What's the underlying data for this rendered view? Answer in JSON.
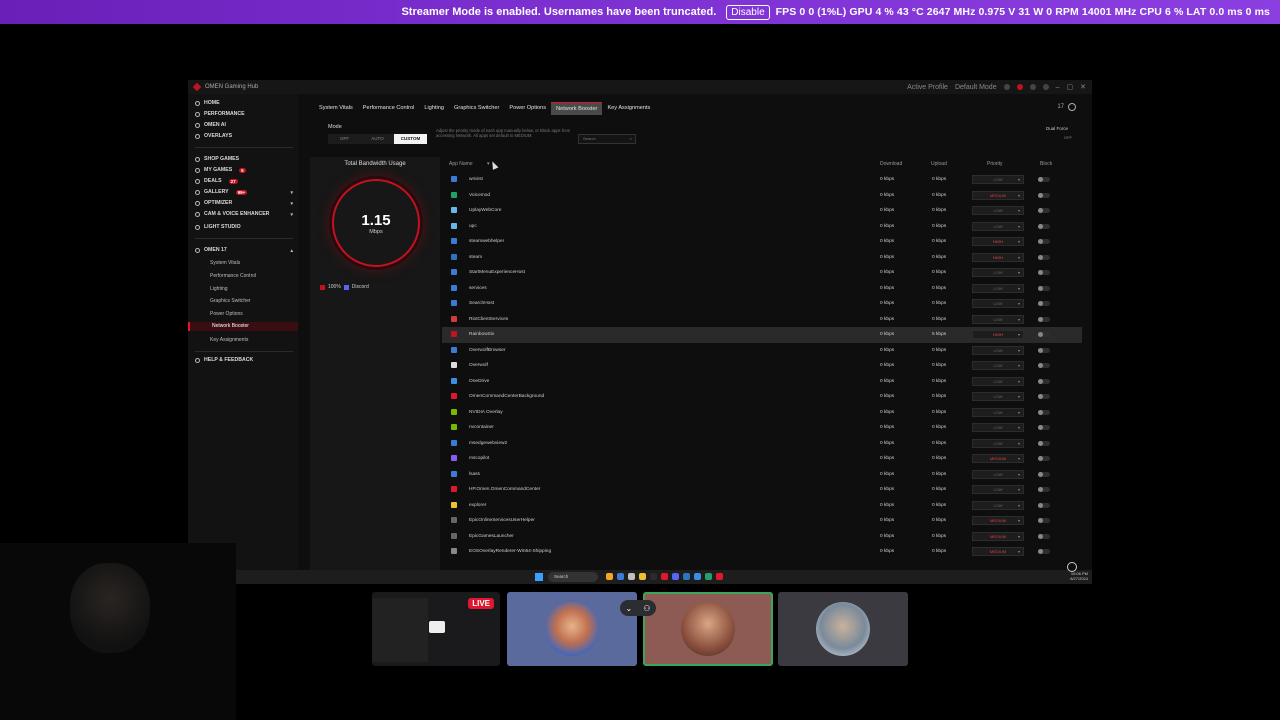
{
  "overlay": {
    "streamer_message": "Streamer Mode is enabled. Usernames have been truncated.",
    "disable_label": "Disable",
    "stats": "FPS 0 0 (1%L)  GPU 4 % 43 °C 2647 MHz 0.975 V 31 W 0 RPM 14001 MHz  CPU 6 %  LAT 0.0 ms 0 ms"
  },
  "window": {
    "title": "OMEN Gaming Hub",
    "profile_label": "Active Profile",
    "profile_value": "Default Mode"
  },
  "sidebar": {
    "items": [
      {
        "label": "HOME"
      },
      {
        "label": "PERFORMANCE"
      },
      {
        "label": "OMEN AI"
      },
      {
        "label": "OVERLAYS"
      },
      {
        "label": "SHOP GAMES"
      },
      {
        "label": "MY GAMES",
        "badge": "5"
      },
      {
        "label": "DEALS",
        "badge": "27"
      },
      {
        "label": "GALLERY",
        "badge": "99+"
      },
      {
        "label": "OPTIMIZER"
      },
      {
        "label": "CAM & VOICE ENHANCER"
      },
      {
        "label": "LIGHT STUDIO"
      }
    ],
    "device": "OMEN 17",
    "sub_items": [
      {
        "label": "System Vitals"
      },
      {
        "label": "Performance Control"
      },
      {
        "label": "Lighting"
      },
      {
        "label": "Graphics Switcher"
      },
      {
        "label": "Power Options"
      },
      {
        "label": "Network Booster"
      },
      {
        "label": "Key Assignments"
      }
    ],
    "help": "HELP & FEEDBACK",
    "version": "BOOSTED"
  },
  "tabs": [
    {
      "label": "System Vitals"
    },
    {
      "label": "Performance Control"
    },
    {
      "label": "Lighting"
    },
    {
      "label": "Graphics Switcher"
    },
    {
      "label": "Power Options"
    },
    {
      "label": "Network Booster",
      "active": true
    },
    {
      "label": "Key Assignments"
    }
  ],
  "tab_right": "17",
  "mode": {
    "label": "Mode",
    "options": [
      "OFF",
      "AUTO",
      "CUSTOM"
    ],
    "selected": "CUSTOM",
    "description": "Adjust the priority mode of each app manually below, or Block apps from accessing Network. All apps set default to MEDIUM.",
    "search_placeholder": "Search",
    "dual_force": "Dual Force",
    "dual_toggle": "OFF"
  },
  "bandwidth": {
    "title": "Total Bandwidth Usage",
    "value": "1.15",
    "unit": "Mbps",
    "legend_percent": "100%",
    "legend_app": "Discord"
  },
  "table": {
    "headers": {
      "app": "App Name",
      "download": "Download",
      "upload": "Upload",
      "priority": "Priority",
      "block": "Block"
    },
    "rows": [
      {
        "name": "wmirst",
        "dl": "0 kbps",
        "ul": "0 kbps",
        "prio": "LOW",
        "color": "#3b7bd6"
      },
      {
        "name": "Voicemod",
        "dl": "0 kbps",
        "ul": "0 kbps",
        "prio": "MEDIUM",
        "color": "#1fa36a"
      },
      {
        "name": "UplayWebCore",
        "dl": "0 kbps",
        "ul": "0 kbps",
        "prio": "LOW",
        "color": "#6bb6e8"
      },
      {
        "name": "upc",
        "dl": "0 kbps",
        "ul": "0 kbps",
        "prio": "LOW",
        "color": "#6bb6e8"
      },
      {
        "name": "steamwebhelper",
        "dl": "0 kbps",
        "ul": "0 kbps",
        "prio": "HIGH",
        "color": "#3b7bd6"
      },
      {
        "name": "steam",
        "dl": "0 kbps",
        "ul": "0 kbps",
        "prio": "HIGH",
        "color": "#2a75bb"
      },
      {
        "name": "StartMenuExperienceHost",
        "dl": "0 kbps",
        "ul": "0 kbps",
        "prio": "LOW",
        "color": "#3b7bd6"
      },
      {
        "name": "services",
        "dl": "0 kbps",
        "ul": "0 kbps",
        "prio": "LOW",
        "color": "#3b7bd6"
      },
      {
        "name": "SearchHost",
        "dl": "0 kbps",
        "ul": "0 kbps",
        "prio": "LOW",
        "color": "#3b7bd6"
      },
      {
        "name": "RiotClientServices",
        "dl": "0 kbps",
        "ul": "0 kbps",
        "prio": "LOW",
        "color": "#d23b3b"
      },
      {
        "name": "RainbowSix",
        "dl": "0 kbps",
        "ul": "5 kbps",
        "prio": "HIGH",
        "color": "#c1121f",
        "highlight": true
      },
      {
        "name": "OverwolfBrowser",
        "dl": "0 kbps",
        "ul": "0 kbps",
        "prio": "LOW",
        "color": "#3b7bd6"
      },
      {
        "name": "Overwolf",
        "dl": "0 kbps",
        "ul": "0 kbps",
        "prio": "LOW",
        "color": "#dddddd"
      },
      {
        "name": "OneDrive",
        "dl": "0 kbps",
        "ul": "0 kbps",
        "prio": "LOW",
        "color": "#3b8ee6"
      },
      {
        "name": "OmenCommandCenterBackground",
        "dl": "0 kbps",
        "ul": "0 kbps",
        "prio": "LOW",
        "color": "#e0182f"
      },
      {
        "name": "NVIDIA Overlay",
        "dl": "0 kbps",
        "ul": "0 kbps",
        "prio": "LOW",
        "color": "#76b900"
      },
      {
        "name": "nvcontainer",
        "dl": "0 kbps",
        "ul": "0 kbps",
        "prio": "LOW",
        "color": "#76b900"
      },
      {
        "name": "msedgewebview2",
        "dl": "0 kbps",
        "ul": "0 kbps",
        "prio": "LOW",
        "color": "#3b7bd6"
      },
      {
        "name": "mscopilot",
        "dl": "0 kbps",
        "ul": "0 kbps",
        "prio": "MEDIUM",
        "color": "#8a5cf5"
      },
      {
        "name": "lsass",
        "dl": "0 kbps",
        "ul": "0 kbps",
        "prio": "LOW",
        "color": "#3b7bd6"
      },
      {
        "name": "HP.Omen.OmenCommandCenter",
        "dl": "0 kbps",
        "ul": "0 kbps",
        "prio": "LOW",
        "color": "#e0182f"
      },
      {
        "name": "explorer",
        "dl": "0 kbps",
        "ul": "0 kbps",
        "prio": "LOW",
        "color": "#f0c030"
      },
      {
        "name": "EpicOnlineServicesUserHelper",
        "dl": "0 kbps",
        "ul": "0 kbps",
        "prio": "MEDIUM",
        "color": "#666666"
      },
      {
        "name": "EpicGamesLauncher",
        "dl": "0 kbps",
        "ul": "0 kbps",
        "prio": "MEDIUM",
        "color": "#666666"
      },
      {
        "name": "EOSOverlayRenderer-Win64-Shipping",
        "dl": "0 kbps",
        "ul": "0 kbps",
        "prio": "MEDIUM",
        "color": "#888888"
      }
    ]
  },
  "taskbar": {
    "search": "Search",
    "time": "10:06 PM",
    "date": "8/27/2024"
  },
  "call": {
    "live_label": "LIVE"
  }
}
